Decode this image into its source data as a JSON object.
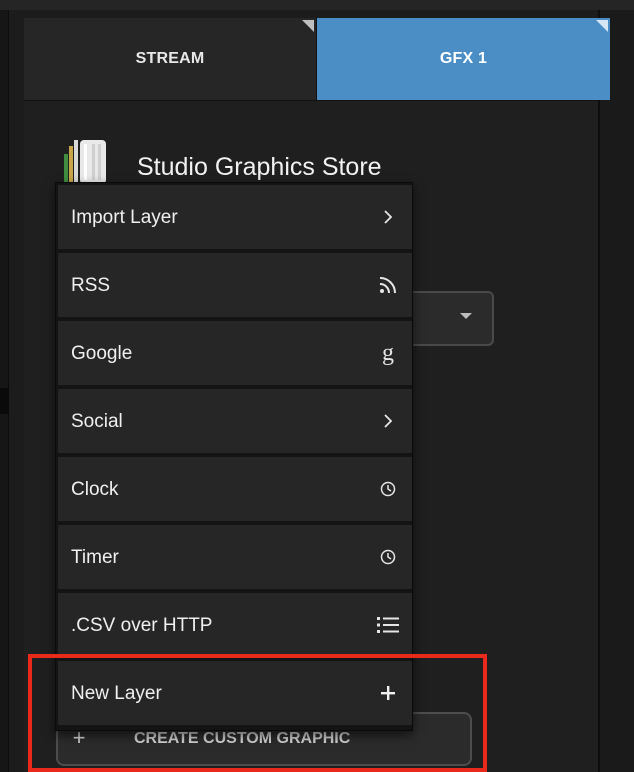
{
  "tabs": [
    {
      "label": "STREAM",
      "active": false
    },
    {
      "label": "GFX 1",
      "active": true
    }
  ],
  "store": {
    "title": "Studio Graphics Store",
    "icon": "store-icon"
  },
  "menu": {
    "items": [
      {
        "label": "Import Layer",
        "icon": "chevron-right-icon"
      },
      {
        "label": "RSS",
        "icon": "rss-icon"
      },
      {
        "label": "Google",
        "icon": "google-icon"
      },
      {
        "label": "Social",
        "icon": "chevron-right-icon"
      },
      {
        "label": "Clock",
        "icon": "clock-icon"
      },
      {
        "label": "Timer",
        "icon": "clock-icon"
      },
      {
        "label": ".CSV over HTTP",
        "icon": "list-icon"
      },
      {
        "label": "New Layer",
        "icon": "plus-icon"
      }
    ]
  },
  "create_button": {
    "label": "CREATE CUSTOM GRAPHIC",
    "icon": "plus-icon"
  },
  "colors": {
    "active_tab": "#4b8ec6",
    "highlight": "#e8291c",
    "menu_item_bg": "#262626"
  }
}
